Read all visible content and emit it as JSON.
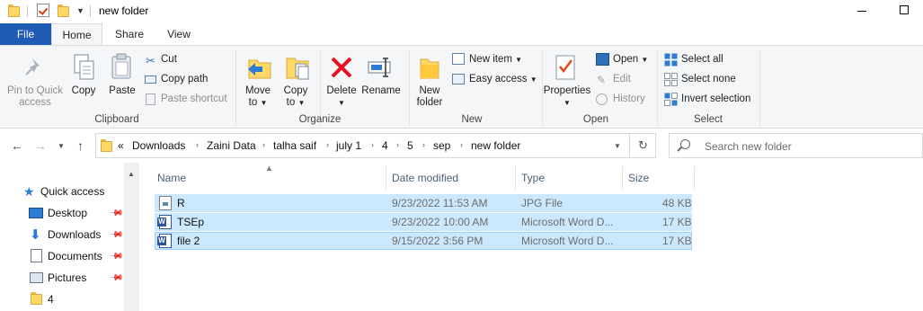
{
  "window": {
    "title": "new folder"
  },
  "tabs": {
    "file": "File",
    "home": "Home",
    "share": "Share",
    "view": "View"
  },
  "ribbon": {
    "clipboard": {
      "pin_label_1": "Pin to Quick",
      "pin_label_2": "access",
      "copy": "Copy",
      "paste": "Paste",
      "cut": "Cut",
      "copy_path": "Copy path",
      "paste_shortcut": "Paste shortcut",
      "group": "Clipboard"
    },
    "organize": {
      "move_to_1": "Move",
      "move_to_2": "to",
      "copy_to_1": "Copy",
      "copy_to_2": "to",
      "delete": "Delete",
      "rename": "Rename",
      "group": "Organize"
    },
    "new": {
      "new_folder_1": "New",
      "new_folder_2": "folder",
      "new_item": "New item",
      "easy_access": "Easy access",
      "group": "New"
    },
    "open": {
      "properties": "Properties",
      "open": "Open",
      "edit": "Edit",
      "history": "History",
      "group": "Open"
    },
    "select": {
      "select_all": "Select all",
      "select_none": "Select none",
      "invert": "Invert selection",
      "group": "Select"
    }
  },
  "address": {
    "overflow": "«",
    "crumbs": [
      "Downloads",
      "Zaini Data",
      "talha saif",
      "july 1",
      "4",
      "5",
      "sep",
      "new folder"
    ]
  },
  "search": {
    "placeholder": "Search new folder"
  },
  "nav": {
    "items": [
      "Quick access",
      "Desktop",
      "Downloads",
      "Documents",
      "Pictures",
      "4"
    ]
  },
  "columns": {
    "name": "Name",
    "date": "Date modified",
    "type": "Type",
    "size": "Size"
  },
  "files": [
    {
      "name": "R",
      "date": "9/23/2022 11:53 AM",
      "type": "JPG File",
      "size": "48 KB",
      "icon": "image-file-icon"
    },
    {
      "name": "TSEp",
      "date": "9/23/2022 10:00 AM",
      "type": "Microsoft Word D...",
      "size": "17 KB",
      "icon": "word-doc-icon"
    },
    {
      "name": "file 2",
      "date": "9/15/2022 3:56 PM",
      "type": "Microsoft Word D...",
      "size": "17 KB",
      "icon": "word-doc-icon"
    }
  ],
  "colors": {
    "accent": "#1f5bb5",
    "selection": "#cce8ff",
    "folder": "#ffd865",
    "delete_red": "#e81123"
  }
}
